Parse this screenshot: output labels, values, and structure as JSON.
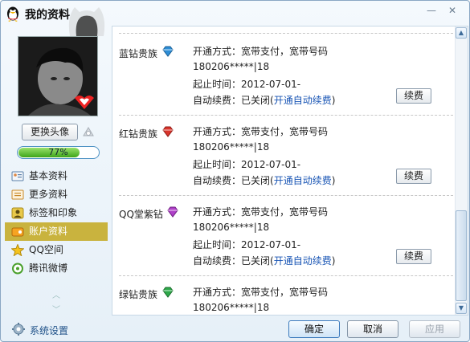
{
  "window": {
    "title": "我的资料"
  },
  "sidebar": {
    "change_avatar_label": "更换头像",
    "completeness": {
      "label": "77%",
      "value": 0.77
    },
    "items": [
      {
        "label": "基本资料",
        "icon": "profile-card-icon",
        "active": false
      },
      {
        "label": "更多资料",
        "icon": "more-info-icon",
        "active": false
      },
      {
        "label": "标签和印象",
        "icon": "tag-icon",
        "active": false
      },
      {
        "label": "账户资料",
        "icon": "account-icon",
        "active": true
      },
      {
        "label": "QQ空间",
        "icon": "qzone-star-icon",
        "active": false
      },
      {
        "label": "腾讯微博",
        "icon": "weibo-icon",
        "active": false
      }
    ]
  },
  "plans": [
    {
      "name": "蓝钻贵族",
      "gem_color": "#2e8ed6",
      "method": "开通方式：宽带支付，宽带号码",
      "account": "180206*****|18",
      "period": "起止时间：2012-07-01-",
      "auto_prefix": "自动续费：已关闭(",
      "auto_link": "开通自动续费",
      "auto_suffix": ")",
      "renew_label": "续费"
    },
    {
      "name": "红钻贵族",
      "gem_color": "#d9352c",
      "method": "开通方式：宽带支付，宽带号码",
      "account": "180206*****|18",
      "period": "起止时间：2012-07-01-",
      "auto_prefix": "自动续费：已关闭(",
      "auto_link": "开通自动续费",
      "auto_suffix": ")",
      "renew_label": "续费"
    },
    {
      "name": "QQ堂紫钻",
      "gem_color": "#b041c9",
      "method": "开通方式：宽带支付，宽带号码",
      "account": "180206*****|18",
      "period": "起止时间：2012-07-01-",
      "auto_prefix": "自动续费：已关闭(",
      "auto_link": "开通自动续费",
      "auto_suffix": ")",
      "renew_label": "续费"
    },
    {
      "name": "绿钻贵族",
      "gem_color": "#2ea84a",
      "method": "开通方式：宽带支付，宽带号码",
      "account": "180206*****|18"
    }
  ],
  "footer": {
    "settings_label": "系统设置",
    "ok_label": "确定",
    "cancel_label": "取消",
    "apply_label": "应用"
  },
  "colors": {
    "accent": "#c9b33e",
    "link": "#1a56b5"
  }
}
